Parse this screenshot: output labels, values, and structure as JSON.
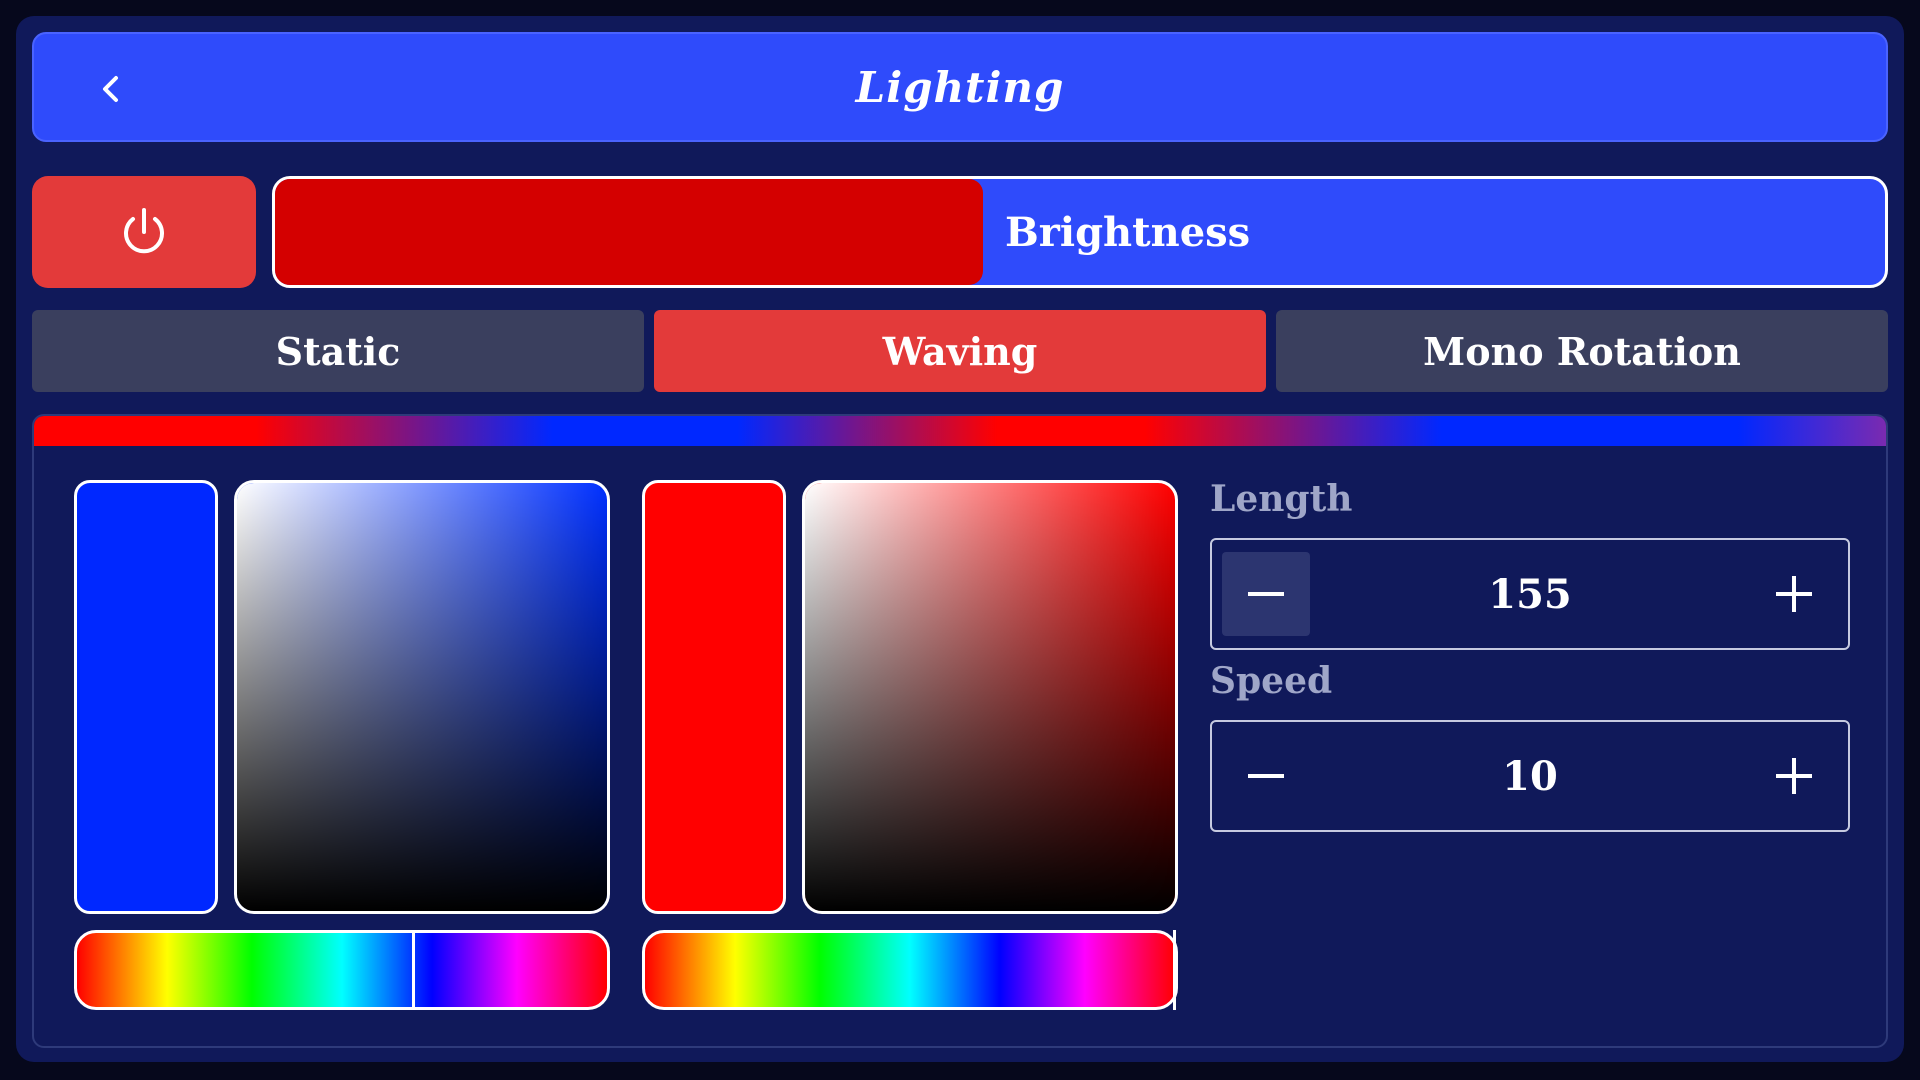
{
  "header": {
    "title": "Lighting"
  },
  "brightness": {
    "label": "Brightness",
    "level": 0.44,
    "fill_color": "#d40000"
  },
  "power": {
    "icon": "power-icon",
    "color": "#e33a3a"
  },
  "tabs": [
    {
      "label": "Static",
      "active": false
    },
    {
      "label": "Waving",
      "active": true
    },
    {
      "label": "Mono Rotation",
      "active": false
    }
  ],
  "colors": {
    "accent": "#2f4bfb",
    "active_tab": "#e33a3a",
    "inactive_tab": "#3a3f5e",
    "color_1": "#0028ff",
    "color_2": "#ff0000"
  },
  "pickers": [
    {
      "swatch": "#0028ff",
      "hue_color": "#0030ff",
      "hue_level": 0.635
    },
    {
      "swatch": "#ff0000",
      "hue_color": "#ff0000",
      "hue_level": 1.0
    }
  ],
  "length": {
    "label": "Length",
    "value": "155"
  },
  "speed": {
    "label": "Speed",
    "value": "10"
  }
}
